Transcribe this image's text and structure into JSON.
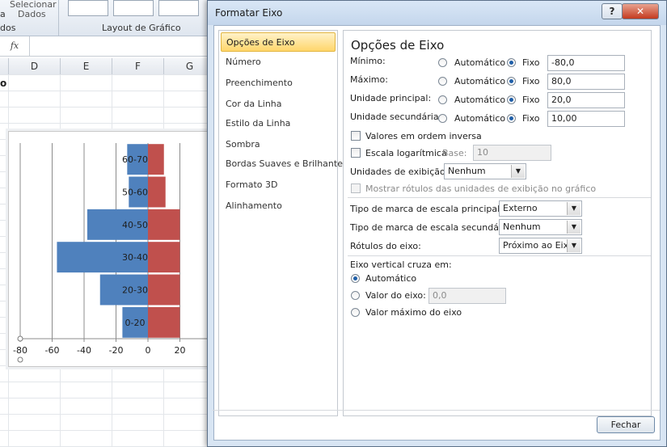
{
  "ribbon": {
    "select_data_line1": "Selecionar",
    "select_data_line2": "Dados",
    "group_left_fragment": "a",
    "group_left_fragment2": "dos",
    "group_layout": "Layout de Gráfico"
  },
  "formula": {
    "fx": "fx",
    "row_label_fragment": "o"
  },
  "columns": [
    "D",
    "E",
    "F",
    "G"
  ],
  "chart_data": {
    "type": "bar",
    "orientation": "horizontal",
    "categories": [
      "0-20",
      "20-30",
      "30-40",
      "40-50",
      "50-60",
      "60-70"
    ],
    "series": [
      {
        "values": [
          -16,
          -30,
          -57,
          -38,
          -12,
          -13
        ]
      },
      {
        "values": [
          20,
          20,
          20,
          20,
          11,
          10
        ]
      }
    ],
    "x_ticks": [
      "-80",
      "-60",
      "-40",
      "-20",
      "0",
      "20"
    ],
    "xlim": [
      -80,
      80
    ],
    "colors": [
      "#4f81bd",
      "#c0504d"
    ],
    "grid": true
  },
  "dialog": {
    "title": "Formatar Eixo",
    "help": "?",
    "close_x": "✕",
    "nav": [
      "Opções de Eixo",
      "Número",
      "Preenchimento",
      "Cor da Linha",
      "Estilo da Linha",
      "Sombra",
      "Bordas Suaves e Brilhantes",
      "Formato 3D",
      "Alinhamento"
    ],
    "panel_title": "Opções de Eixo",
    "rows": [
      {
        "label": "Mínimo:",
        "auto": "Automático",
        "fixed": "Fixo",
        "value": "-80,0"
      },
      {
        "label": "Máximo:",
        "auto": "Automático",
        "fixed": "Fixo",
        "value": "80,0"
      },
      {
        "label": "Unidade principal:",
        "auto": "Automático",
        "fixed": "Fixo",
        "value": "20,0"
      },
      {
        "label": "Unidade secundária:",
        "auto": "Automático",
        "fixed": "Fixo",
        "value": "10,00"
      }
    ],
    "reverse": "Valores em ordem inversa",
    "log_scale": "Escala logarítmica",
    "base_label": "Base:",
    "base_value": "10",
    "display_units_label": "Unidades de exibição:",
    "display_units_value": "Nenhum",
    "show_units_label": "Mostrar rótulos das unidades de exibição no gráfico",
    "major_tick_label": "Tipo de marca de escala principal:",
    "major_tick_value": "Externo",
    "minor_tick_label": "Tipo de marca de escala secundária:",
    "minor_tick_value": "Nenhum",
    "axis_labels_label": "Rótulos do eixo:",
    "axis_labels_value": "Próximo ao Eixo",
    "crosses_heading": "Eixo vertical cruza em:",
    "crosses_auto": "Automático",
    "crosses_value_label": "Valor do eixo:",
    "crosses_value": "0,0",
    "crosses_max": "Valor máximo do eixo",
    "close_button": "Fechar"
  }
}
